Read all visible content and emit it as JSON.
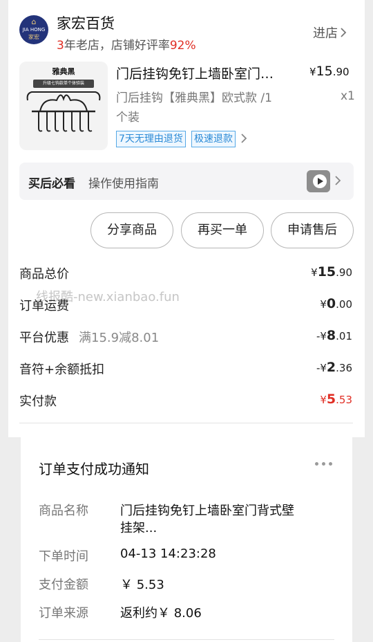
{
  "store": {
    "logo_en": "JIA HONG",
    "logo_cn": "家宏",
    "name": "家宏百货",
    "years": "3",
    "info_text": "年老店，店铺好评率",
    "rating": "92%",
    "enter_label": "进店"
  },
  "product": {
    "thumb_label": "雅典黑",
    "thumb_sub": "升级七钩款单个体验装",
    "title": "门后挂钩免钉上墙卧室门…",
    "price_symbol": "¥",
    "price_int": "15",
    "price_dec": ".90",
    "spec_line1": "门后挂钩【雅典黑】欧式款 /1",
    "spec_line2": "个装",
    "quantity": "x1",
    "tags": [
      "7天无理由退货",
      "极速退款"
    ]
  },
  "guide": {
    "title": "买后必看",
    "text": "操作使用指南"
  },
  "buttons": {
    "share": "分享商品",
    "rebuy": "再买一单",
    "aftersale": "申请售后"
  },
  "summary": {
    "total_label": "商品总价",
    "total_sym": "¥",
    "total_int": "15",
    "total_dec": ".90",
    "shipping_label": "订单运费",
    "shipping_sym": "¥",
    "shipping_int": "0",
    "shipping_dec": ".00",
    "discount_label": "平台优惠",
    "discount_note": "满15.9减8.01",
    "discount_sym": "-¥",
    "discount_int": "8",
    "discount_dec": ".01",
    "balance_label": "音符+余额抵扣",
    "balance_sym": "-¥",
    "balance_int": "2",
    "balance_dec": ".36",
    "paid_label": "实付款",
    "paid_sym": "¥",
    "paid_int": "5",
    "paid_dec": ".53",
    "watermark": "线报酷-new.xianbao.fun"
  },
  "notification": {
    "title": "订单支付成功通知",
    "rows": [
      {
        "label": "商品名称",
        "value_line1": "门后挂钩免钉上墙卧室门背式壁",
        "value_line2": "挂架..."
      },
      {
        "label": "下单时间",
        "value": "04-13 14:23:28"
      },
      {
        "label": "支付金额",
        "value": "￥ 5.53"
      },
      {
        "label": "订单来源",
        "value": "返利约￥ 8.06"
      }
    ]
  },
  "colors": {
    "accent_red": "#e02e24",
    "tag_blue": "#2a8ad6",
    "logo_navy": "#23337a"
  }
}
